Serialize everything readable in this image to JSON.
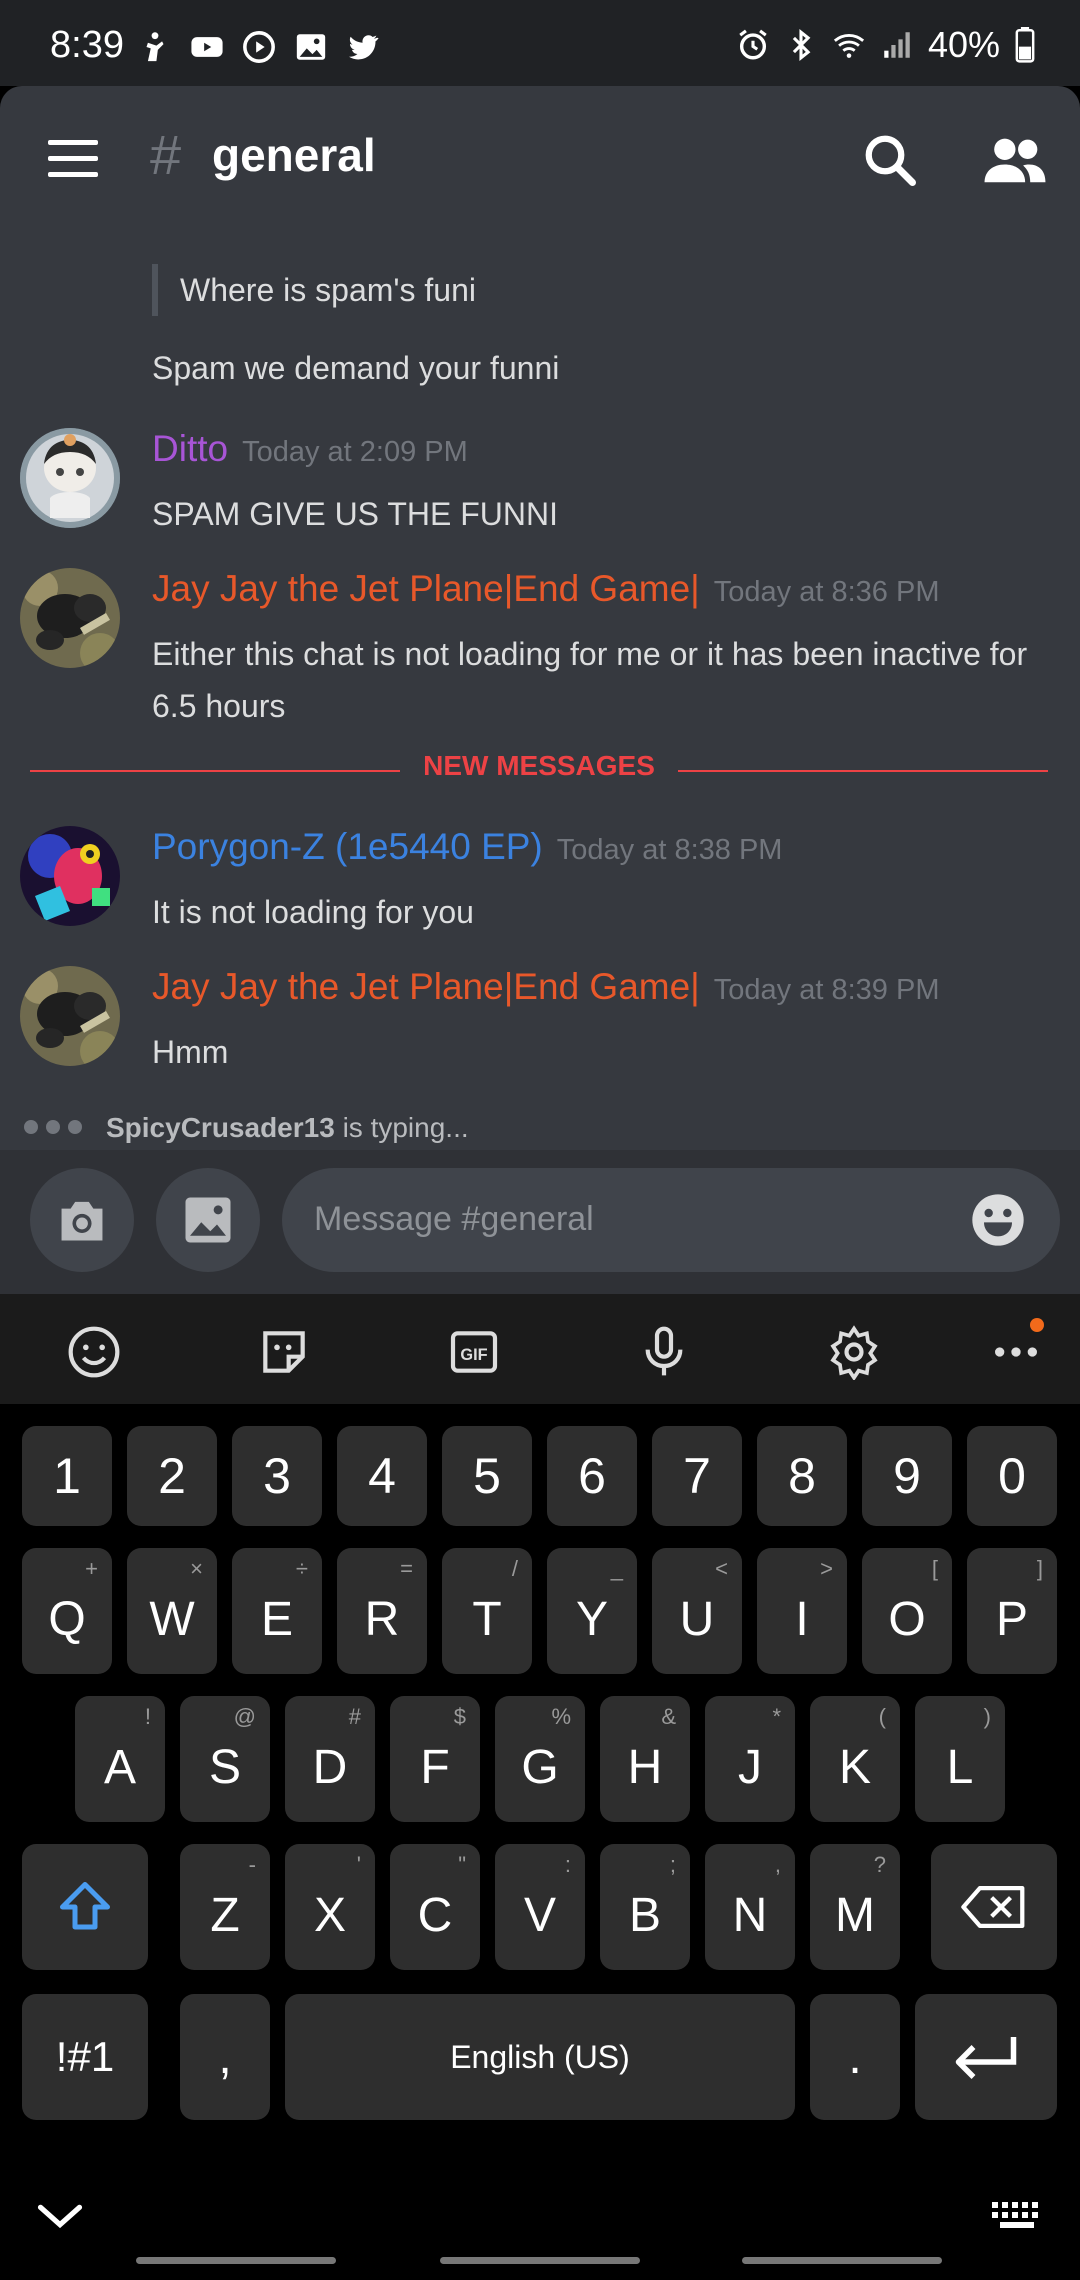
{
  "status_bar": {
    "time": "8:39",
    "battery": "40%",
    "left_icons": [
      "accessibility-icon",
      "youtube-icon",
      "play-circle-icon",
      "image-icon",
      "twitter-icon"
    ],
    "right_icons": [
      "alarm-icon",
      "bluetooth-icon",
      "wifi-icon",
      "signal-icon",
      "battery-icon"
    ]
  },
  "header": {
    "hash": "#",
    "channel": "general"
  },
  "chat": {
    "quote": "Where is spam's funi",
    "plain_line": "Spam we demand your funni",
    "messages": [
      {
        "user": "Ditto",
        "time": "Today at 2:09 PM",
        "text": "SPAM GIVE US THE FUNNI",
        "color": "#a855d6"
      },
      {
        "user": "Jay Jay the Jet Plane|End Game|",
        "time": "Today at 8:36 PM",
        "text": "Either this chat is not loading for me or it has been inactive for 6.5 hours",
        "color": "#e8582a"
      },
      {
        "user": "Porygon-Z (1e5440 EP)",
        "time": "Today at 8:38 PM",
        "text": "It is not loading for you",
        "color": "#3b82e0"
      },
      {
        "user": "Jay Jay the Jet Plane|End Game|",
        "time": "Today at 8:39 PM",
        "text": "Hmm",
        "color": "#e8582a"
      }
    ],
    "new_messages_label": "NEW MESSAGES"
  },
  "typing": {
    "user": "SpicyCrusader13",
    "suffix": " is typing..."
  },
  "input": {
    "placeholder": "Message #general"
  },
  "keyboard": {
    "numbers": [
      "1",
      "2",
      "3",
      "4",
      "5",
      "6",
      "7",
      "8",
      "9",
      "0"
    ],
    "row1": [
      [
        "Q",
        "+"
      ],
      [
        "W",
        "×"
      ],
      [
        "E",
        "÷"
      ],
      [
        "R",
        "="
      ],
      [
        "T",
        "/"
      ],
      [
        "Y",
        "_"
      ],
      [
        "U",
        "<"
      ],
      [
        "I",
        ">"
      ],
      [
        "O",
        "["
      ],
      [
        "P",
        "]"
      ]
    ],
    "row2": [
      [
        "A",
        "!"
      ],
      [
        "S",
        "@"
      ],
      [
        "D",
        "#"
      ],
      [
        "F",
        "$"
      ],
      [
        "G",
        "%"
      ],
      [
        "H",
        "&"
      ],
      [
        "J",
        "*"
      ],
      [
        "K",
        "("
      ],
      [
        "L",
        ")"
      ]
    ],
    "row3": [
      [
        "Z",
        "-"
      ],
      [
        "X",
        "'"
      ],
      [
        "C",
        "\""
      ],
      [
        "V",
        ":"
      ],
      [
        "B",
        ";"
      ],
      [
        "N",
        ","
      ],
      [
        "M",
        "?"
      ]
    ],
    "symbols_key": "!#1",
    "comma_key": ",",
    "space_label": "English (US)",
    "period_key": "."
  },
  "colors": {
    "accent_new": "#ed4245",
    "chat_bg": "#36393f",
    "input_bg": "#40444b"
  }
}
